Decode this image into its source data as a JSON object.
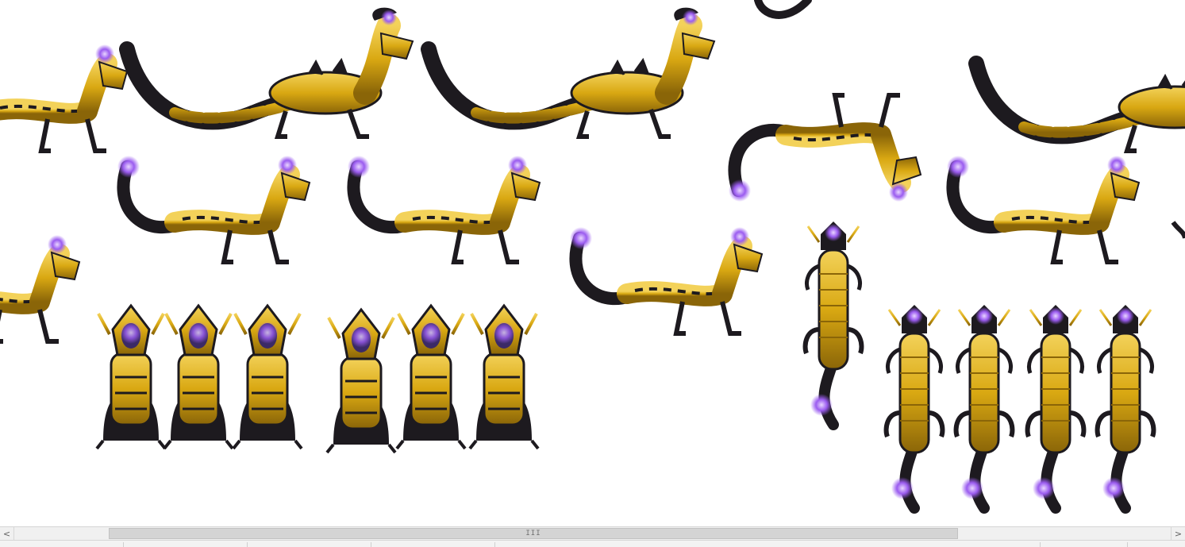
{
  "scrollbar": {
    "grip": "III",
    "left_arrow": "<",
    "right_arrow": ">"
  },
  "colors": {
    "gold": "#d9a812",
    "gold_light": "#f3d25a",
    "dark": "#1d1a1f",
    "purple": "#8f4fe6",
    "purple_glow": "#c9a2ff"
  },
  "sprites": {
    "icon": "golden-dragon-icon"
  }
}
